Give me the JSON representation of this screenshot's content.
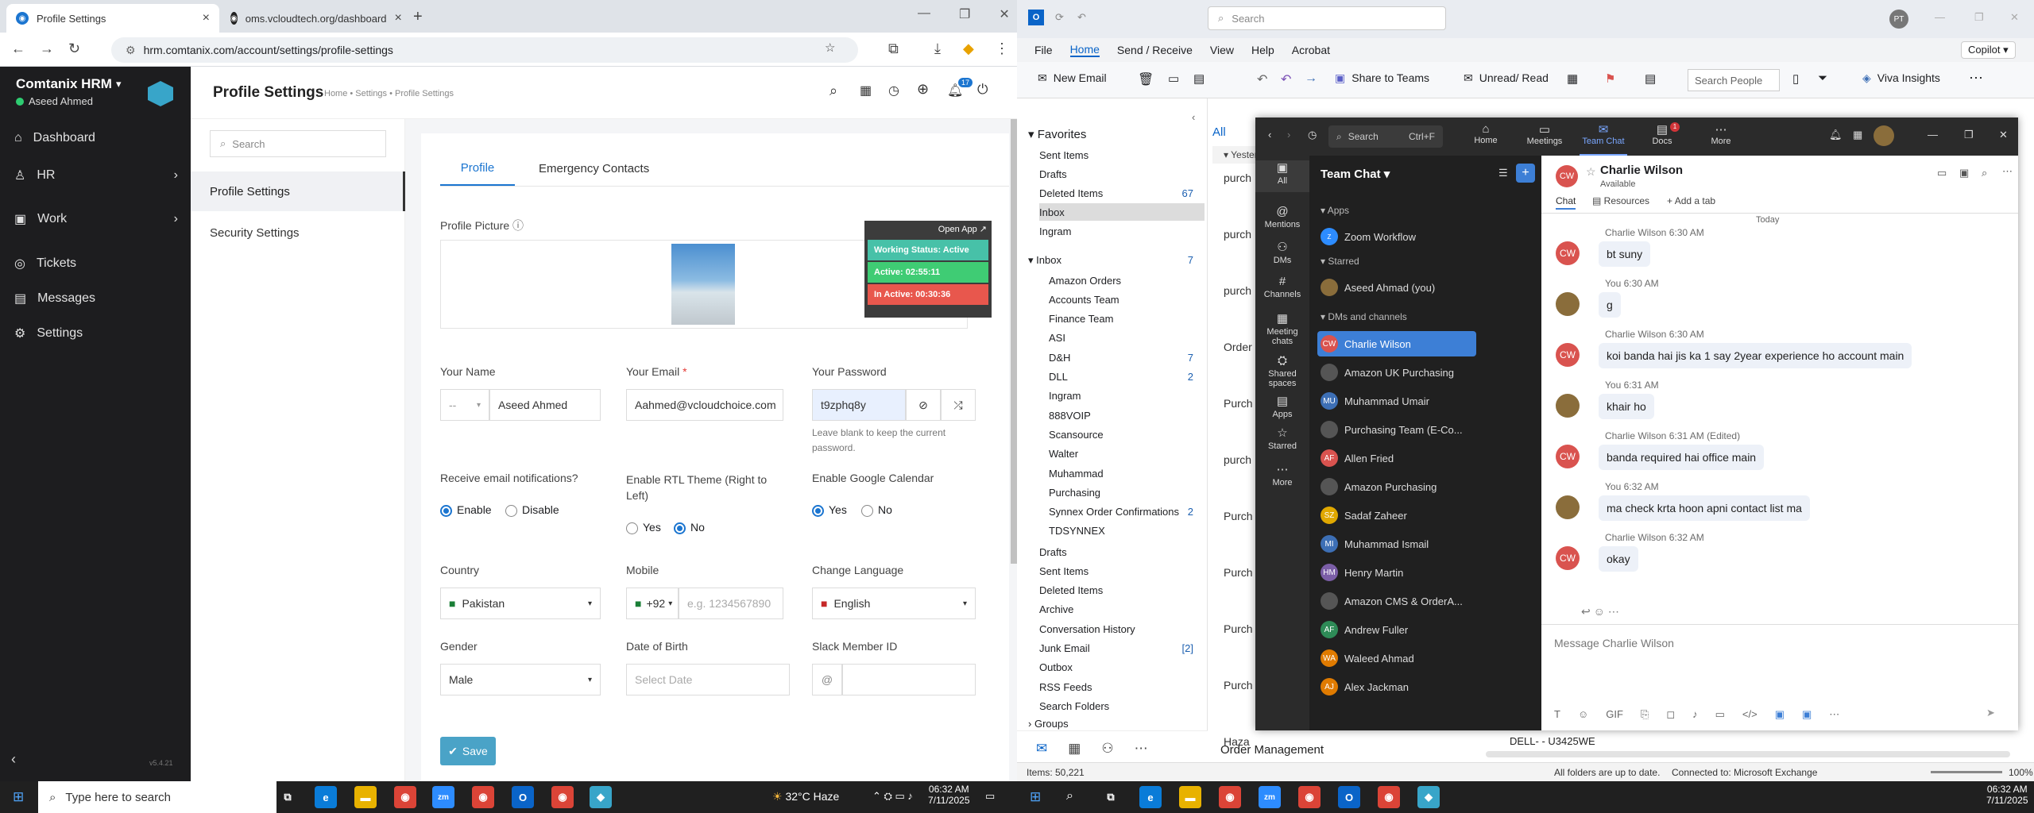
{
  "browser": {
    "tabs": [
      {
        "title": "Profile Settings"
      },
      {
        "title": "oms.vcloudtech.org/dashboard"
      }
    ],
    "url": "hrm.comtanix.com/account/settings/profile-settings"
  },
  "hrm": {
    "brand": "Comtanix HRM",
    "user": "Aseed Ahmed",
    "menu": [
      {
        "label": "Dashboard",
        "icon": "home-icon"
      },
      {
        "label": "HR",
        "icon": "hr-icon"
      },
      {
        "label": "Work",
        "icon": "briefcase-icon"
      },
      {
        "label": "Tickets",
        "icon": "ticket-icon"
      },
      {
        "label": "Messages",
        "icon": "message-icon"
      },
      {
        "label": "Settings",
        "icon": "settings-icon"
      }
    ],
    "version": "v5.4.21",
    "page_title": "Profile Settings",
    "breadcrumb": "Home • Settings • Profile Settings",
    "notif_count": "17",
    "search_placeholder": "Search",
    "settings_nav": [
      "Profile Settings",
      "Security Settings"
    ],
    "tabs": [
      "Profile",
      "Emergency Contacts"
    ],
    "status": {
      "open_app": "Open App ↗",
      "working": "Working Status: Active",
      "active": "Active: 02:55:11",
      "inactive": "In Active: 00:30:36"
    },
    "profile_picture_label": "Profile Picture",
    "fields": {
      "name_label": "Your Name",
      "salutation": "--",
      "name": "Aseed Ahmed",
      "email_label": "Your Email",
      "email": "Aahmed@vcloudchoice.com",
      "password_label": "Your Password",
      "password": "t9zphq8y",
      "password_hint": "Leave blank to keep the current password.",
      "email_notif_label": "Receive email notifications?",
      "enable": "Enable",
      "disable": "Disable",
      "rtl_label": "Enable RTL Theme (Right to Left)",
      "yes": "Yes",
      "no": "No",
      "gcal_label": "Enable Google Calendar",
      "country_label": "Country",
      "country": "Pakistan",
      "mobile_label": "Mobile",
      "mobile_code": "+92",
      "mobile_placeholder": "e.g. 1234567890",
      "language_label": "Change Language",
      "language": "English",
      "gender_label": "Gender",
      "gender": "Male",
      "dob_label": "Date of Birth",
      "dob_placeholder": "Select Date",
      "slack_label": "Slack Member ID",
      "slack_prefix": "@"
    },
    "save": "Save"
  },
  "outlook": {
    "search_placeholder": "Search",
    "menu": [
      "File",
      "Home",
      "Send / Receive",
      "View",
      "Help",
      "Acrobat"
    ],
    "copilot": "Copilot",
    "ribbon": {
      "new_email": "New Email",
      "share": "Share to Teams",
      "unread": "Unread/ Read",
      "search_people": "Search People",
      "viva": "Viva Insights"
    },
    "favorites_label": "Favorites",
    "favorites": [
      {
        "name": "Sent Items",
        "count": ""
      },
      {
        "name": "Drafts",
        "count": ""
      },
      {
        "name": "Deleted Items",
        "count": "67"
      },
      {
        "name": "Inbox",
        "count": ""
      },
      {
        "name": "Ingram",
        "count": ""
      }
    ],
    "inbox_label": "Inbox",
    "inbox_count": "7",
    "inbox_folders": [
      {
        "name": "Amazon Orders",
        "count": ""
      },
      {
        "name": "Accounts Team",
        "count": ""
      },
      {
        "name": "Finance Team",
        "count": ""
      },
      {
        "name": "ASI",
        "count": ""
      },
      {
        "name": "D&H",
        "count": "7"
      },
      {
        "name": "DLL",
        "count": "2"
      },
      {
        "name": "Ingram",
        "count": ""
      },
      {
        "name": "888VOIP",
        "count": ""
      },
      {
        "name": "Scansource",
        "count": ""
      },
      {
        "name": "Walter",
        "count": ""
      },
      {
        "name": "Muhammad",
        "count": ""
      },
      {
        "name": "Purchasing",
        "count": ""
      },
      {
        "name": "Synnex Order Confirmations",
        "count": "2"
      },
      {
        "name": "TDSYNNEX",
        "count": ""
      }
    ],
    "other_folders": [
      {
        "name": "Drafts",
        "count": ""
      },
      {
        "name": "Sent Items",
        "count": ""
      },
      {
        "name": "Deleted Items",
        "count": ""
      },
      {
        "name": "Archive",
        "count": ""
      },
      {
        "name": "Conversation History",
        "count": ""
      },
      {
        "name": "Junk Email",
        "count": "[2]"
      },
      {
        "name": "Outbox",
        "count": ""
      },
      {
        "name": "RSS Feeds",
        "count": ""
      },
      {
        "name": "Search Folders",
        "count": ""
      }
    ],
    "groups": "Groups",
    "list_tab": "All",
    "list_group": "Yester",
    "list_items": [
      "purch",
      "purch",
      "purch",
      "Order",
      "Purch",
      "purch",
      "Purch",
      "Purch",
      "Purch",
      "Purch",
      "Haza"
    ],
    "list_bottom": "Order Management",
    "reading_snippet": "DELL-       - U3425WE",
    "status": {
      "items": "Items: 50,221",
      "sync": "All folders are up to date.",
      "connection": "Connected to: Microsoft Exchange",
      "zoom": "100%"
    }
  },
  "teams": {
    "search": "Search",
    "shortcut": "Ctrl+F",
    "nav": [
      {
        "label": "Home"
      },
      {
        "label": "Meetings"
      },
      {
        "label": "Team Chat"
      },
      {
        "label": "Docs",
        "badge": "1"
      },
      {
        "label": "More"
      }
    ],
    "rail": [
      "All",
      "Mentions",
      "DMs",
      "Channels",
      "Meeting chats",
      "Shared spaces",
      "Apps",
      "Starred",
      "More"
    ],
    "chat_title": "Team Chat",
    "sections": {
      "apps": "Apps",
      "starred": "Starred",
      "dms": "DMs and channels"
    },
    "zoom_workflow": "Zoom Workflow",
    "starred": [
      {
        "name": "Aseed Ahmad (you)",
        "initials": "",
        "color": "#8a6d3b"
      }
    ],
    "dms": [
      {
        "name": "Charlie Wilson",
        "initials": "CW",
        "color": "#d9534f"
      },
      {
        "name": "Amazon UK Purchasing",
        "initials": "",
        "color": "#555555"
      },
      {
        "name": "Muhammad Umair",
        "initials": "MU",
        "color": "#3d6fb5"
      },
      {
        "name": "Purchasing Team (E-Co...",
        "initials": "",
        "color": "#555555"
      },
      {
        "name": "Allen Fried",
        "initials": "AF",
        "color": "#d9534f"
      },
      {
        "name": "Amazon Purchasing",
        "initials": "",
        "color": "#555555"
      },
      {
        "name": "Sadaf Zaheer",
        "initials": "SZ",
        "color": "#e0a800"
      },
      {
        "name": "Muhammad Ismail",
        "initials": "MI",
        "color": "#3d6fb5"
      },
      {
        "name": "Henry Martin",
        "initials": "HM",
        "color": "#7b5ea7"
      },
      {
        "name": "Amazon CMS & OrderA...",
        "initials": "",
        "color": "#555555"
      },
      {
        "name": "Andrew Fuller",
        "initials": "AF",
        "color": "#2e8b57"
      },
      {
        "name": "Waleed Ahmad",
        "initials": "WA",
        "color": "#e07b00"
      },
      {
        "name": "Alex Jackman",
        "initials": "AJ",
        "color": "#e07b00"
      }
    ],
    "contact": {
      "name": "Charlie Wilson",
      "status": "Available",
      "initials": "CW"
    },
    "tabs": [
      "Chat",
      "Resources",
      "Add a tab"
    ],
    "day": "Today",
    "messages": [
      {
        "who": "Charlie Wilson",
        "time": "6:30 AM",
        "text": "bt suny",
        "mine": false
      },
      {
        "who": "You",
        "time": "6:30 AM",
        "text": "g",
        "mine": true
      },
      {
        "who": "Charlie Wilson",
        "time": "6:30 AM",
        "text": "koi banda hai jis ka 1 say 2year experience ho account main",
        "mine": false
      },
      {
        "who": "You",
        "time": "6:31 AM",
        "text": "khair ho",
        "mine": true
      },
      {
        "who": "Charlie Wilson",
        "time": "6:31 AM (Edited)",
        "text": "banda required hai office main",
        "mine": false
      },
      {
        "who": "You",
        "time": "6:32 AM",
        "text": "ma check krta hoon apni contact list ma",
        "mine": true
      },
      {
        "who": "Charlie Wilson",
        "time": "6:32 AM",
        "text": "okay",
        "mine": false
      }
    ],
    "compose_placeholder": "Message Charlie Wilson"
  },
  "taskbar": {
    "search_placeholder": "Type here to search",
    "weather": "32°C  Haze",
    "clock_left": {
      "time": "06:32 AM",
      "date": "7/11/2025"
    },
    "clock_right": {
      "time": "06:32 AM",
      "date": "7/11/2025"
    }
  }
}
